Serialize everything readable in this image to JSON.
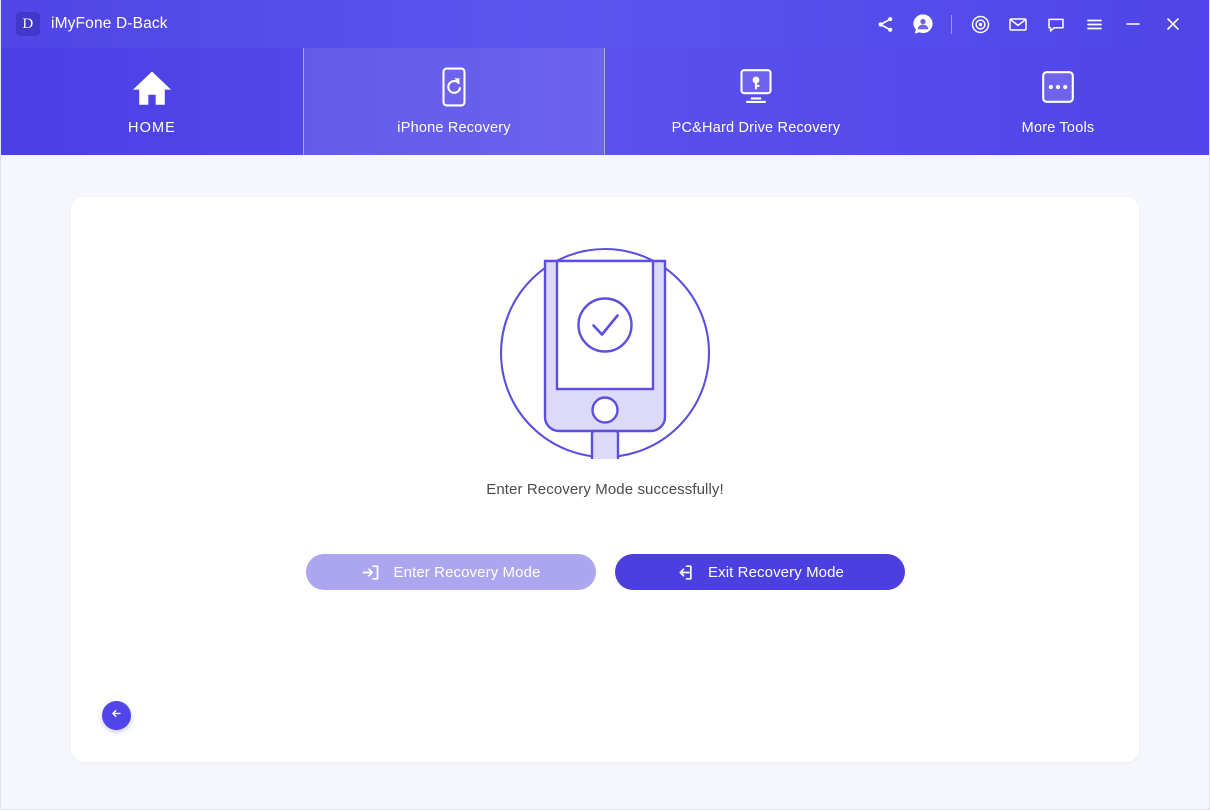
{
  "window": {
    "title": "iMyFone D-Back",
    "logo_letter": "D"
  },
  "titlebar": {
    "icons": [
      {
        "name": "share-icon",
        "label": "Share"
      },
      {
        "name": "account-icon",
        "label": "Account"
      },
      {
        "name": "settings-icon",
        "label": "Settings"
      },
      {
        "name": "mail-icon",
        "label": "Mail"
      },
      {
        "name": "feedback-icon",
        "label": "Feedback"
      },
      {
        "name": "menu-icon",
        "label": "Menu"
      },
      {
        "name": "minimize-icon",
        "label": "Minimize"
      },
      {
        "name": "close-icon",
        "label": "Close"
      }
    ]
  },
  "nav": {
    "tabs": [
      {
        "label": "HOME",
        "icon": "home-icon",
        "active": false
      },
      {
        "label": "iPhone Recovery",
        "icon": "phone-refresh-icon",
        "active": true
      },
      {
        "label": "PC&Hard Drive Recovery",
        "icon": "monitor-key-icon",
        "active": false
      },
      {
        "label": "More Tools",
        "icon": "ellipsis-box-icon",
        "active": false
      }
    ]
  },
  "main": {
    "illustration": "phone-recovery-success-illustration",
    "status_text": "Enter Recovery Mode successfully!",
    "buttons": {
      "enter": {
        "label": "Enter Recovery Mode",
        "icon": "enter-arrow-icon",
        "disabled": true
      },
      "exit": {
        "label": "Exit Recovery Mode",
        "icon": "exit-arrow-icon",
        "disabled": false
      }
    },
    "back_button": {
      "icon": "arrow-left-icon",
      "label": "Back"
    }
  },
  "colors": {
    "brand_purple": "#4f45e8",
    "accent_dark": "#4138c9",
    "button_primary": "#4b3fe0",
    "button_disabled": "#aba6ee",
    "illustration_stroke": "#5b4fe0",
    "illustration_fill": "#dcdaf8",
    "page_background": "#f6f7fc",
    "card_background": "#ffffff",
    "status_text": "#4a4a4f"
  }
}
